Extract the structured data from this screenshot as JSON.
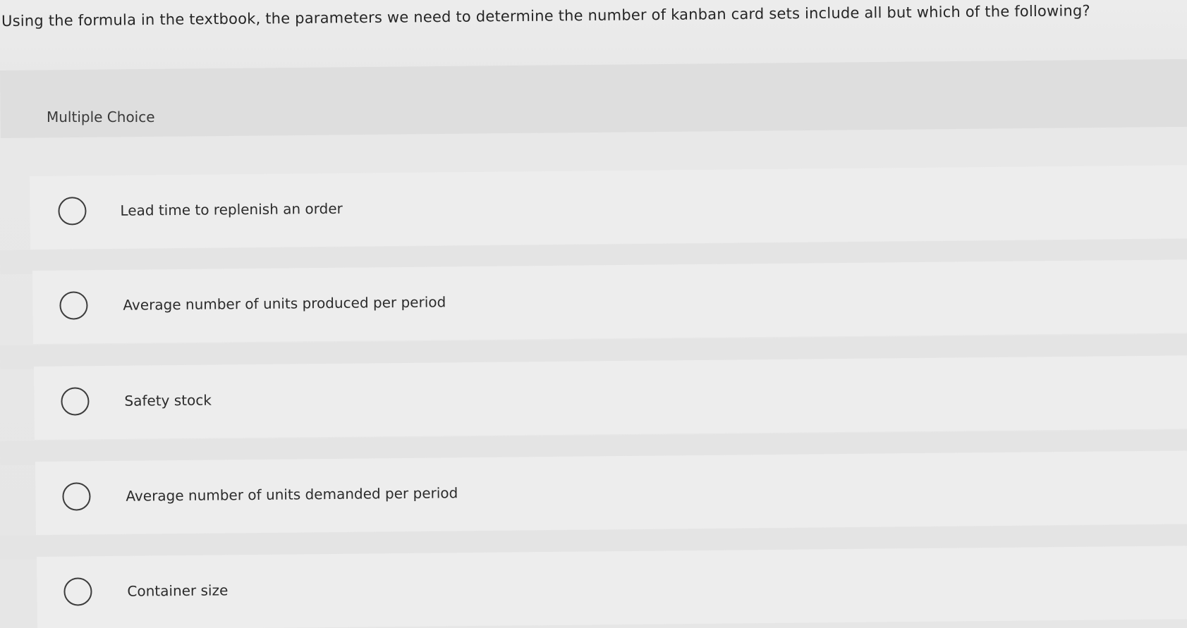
{
  "question": {
    "text": "Using the formula in the textbook, the parameters we need to determine the number of kanban card sets include all but which of the following?"
  },
  "section": {
    "label": "Multiple Choice"
  },
  "choices": [
    {
      "label": "Lead time to replenish an order",
      "selected": false
    },
    {
      "label": "Average number of units produced per period",
      "selected": false
    },
    {
      "label": "Safety stock",
      "selected": false
    },
    {
      "label": "Average number of units demanded per period",
      "selected": false
    },
    {
      "label": "Container size",
      "selected": false
    }
  ]
}
